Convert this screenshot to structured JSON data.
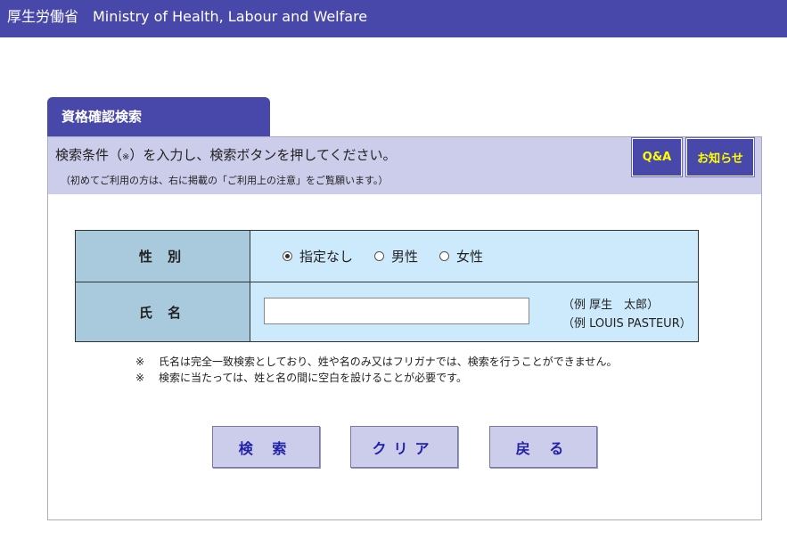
{
  "header": {
    "title": "厚生労働省　Ministry of Health, Labour and Welfare"
  },
  "tab": {
    "label": "資格確認検索"
  },
  "notice": {
    "main_before": "検索条件（",
    "main_mark": "※",
    "main_after": "）を入力し、検索ボタンを押してください。",
    "sub": "（初めてご利用の方は、右に掲載の「ご利用上の注意」をご覧願います。）"
  },
  "buttons": {
    "qa": "Q&A",
    "info": "お知らせ",
    "search": "検 索",
    "clear": "クリア",
    "back": "戻 る"
  },
  "form": {
    "gender_label": "性 別",
    "gender_options": [
      {
        "label": "指定なし",
        "checked": true
      },
      {
        "label": "男性",
        "checked": false
      },
      {
        "label": "女性",
        "checked": false
      }
    ],
    "name_label": "氏 名",
    "name_value": "",
    "name_example_1": "（例 厚生　太郎）",
    "name_example_2": "（例 LOUIS PASTEUR）"
  },
  "notes": [
    {
      "mark": "※",
      "text": "氏名は完全一致検索としており、姓や名のみ又はフリガナでは、検索を行うことができません。"
    },
    {
      "mark": "※",
      "text": "検索に当たっては、姓と名の間に空白を設けることが必要です。"
    }
  ],
  "colors": {
    "header_bg": "#4848aa",
    "notice_bg": "#cccceb",
    "label_cell_bg": "#a9c9dd",
    "value_cell_bg": "#cdeafc",
    "small_button_text": "#ffff00",
    "big_button_text": "#2222aa"
  }
}
